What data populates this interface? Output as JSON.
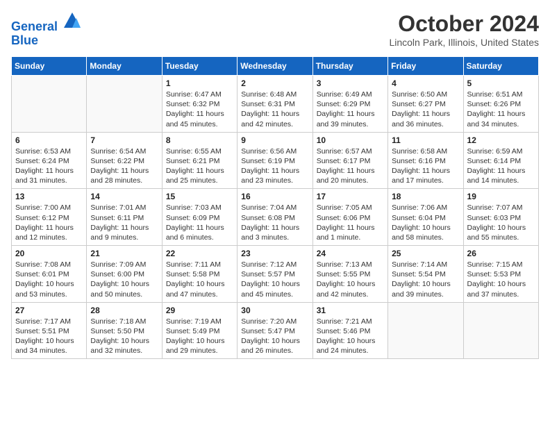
{
  "header": {
    "logo_line1": "General",
    "logo_line2": "Blue",
    "month_title": "October 2024",
    "location": "Lincoln Park, Illinois, United States"
  },
  "days_of_week": [
    "Sunday",
    "Monday",
    "Tuesday",
    "Wednesday",
    "Thursday",
    "Friday",
    "Saturday"
  ],
  "weeks": [
    [
      {
        "day": "",
        "info": ""
      },
      {
        "day": "",
        "info": ""
      },
      {
        "day": "1",
        "info": "Sunrise: 6:47 AM\nSunset: 6:32 PM\nDaylight: 11 hours and 45 minutes."
      },
      {
        "day": "2",
        "info": "Sunrise: 6:48 AM\nSunset: 6:31 PM\nDaylight: 11 hours and 42 minutes."
      },
      {
        "day": "3",
        "info": "Sunrise: 6:49 AM\nSunset: 6:29 PM\nDaylight: 11 hours and 39 minutes."
      },
      {
        "day": "4",
        "info": "Sunrise: 6:50 AM\nSunset: 6:27 PM\nDaylight: 11 hours and 36 minutes."
      },
      {
        "day": "5",
        "info": "Sunrise: 6:51 AM\nSunset: 6:26 PM\nDaylight: 11 hours and 34 minutes."
      }
    ],
    [
      {
        "day": "6",
        "info": "Sunrise: 6:53 AM\nSunset: 6:24 PM\nDaylight: 11 hours and 31 minutes."
      },
      {
        "day": "7",
        "info": "Sunrise: 6:54 AM\nSunset: 6:22 PM\nDaylight: 11 hours and 28 minutes."
      },
      {
        "day": "8",
        "info": "Sunrise: 6:55 AM\nSunset: 6:21 PM\nDaylight: 11 hours and 25 minutes."
      },
      {
        "day": "9",
        "info": "Sunrise: 6:56 AM\nSunset: 6:19 PM\nDaylight: 11 hours and 23 minutes."
      },
      {
        "day": "10",
        "info": "Sunrise: 6:57 AM\nSunset: 6:17 PM\nDaylight: 11 hours and 20 minutes."
      },
      {
        "day": "11",
        "info": "Sunrise: 6:58 AM\nSunset: 6:16 PM\nDaylight: 11 hours and 17 minutes."
      },
      {
        "day": "12",
        "info": "Sunrise: 6:59 AM\nSunset: 6:14 PM\nDaylight: 11 hours and 14 minutes."
      }
    ],
    [
      {
        "day": "13",
        "info": "Sunrise: 7:00 AM\nSunset: 6:12 PM\nDaylight: 11 hours and 12 minutes."
      },
      {
        "day": "14",
        "info": "Sunrise: 7:01 AM\nSunset: 6:11 PM\nDaylight: 11 hours and 9 minutes."
      },
      {
        "day": "15",
        "info": "Sunrise: 7:03 AM\nSunset: 6:09 PM\nDaylight: 11 hours and 6 minutes."
      },
      {
        "day": "16",
        "info": "Sunrise: 7:04 AM\nSunset: 6:08 PM\nDaylight: 11 hours and 3 minutes."
      },
      {
        "day": "17",
        "info": "Sunrise: 7:05 AM\nSunset: 6:06 PM\nDaylight: 11 hours and 1 minute."
      },
      {
        "day": "18",
        "info": "Sunrise: 7:06 AM\nSunset: 6:04 PM\nDaylight: 10 hours and 58 minutes."
      },
      {
        "day": "19",
        "info": "Sunrise: 7:07 AM\nSunset: 6:03 PM\nDaylight: 10 hours and 55 minutes."
      }
    ],
    [
      {
        "day": "20",
        "info": "Sunrise: 7:08 AM\nSunset: 6:01 PM\nDaylight: 10 hours and 53 minutes."
      },
      {
        "day": "21",
        "info": "Sunrise: 7:09 AM\nSunset: 6:00 PM\nDaylight: 10 hours and 50 minutes."
      },
      {
        "day": "22",
        "info": "Sunrise: 7:11 AM\nSunset: 5:58 PM\nDaylight: 10 hours and 47 minutes."
      },
      {
        "day": "23",
        "info": "Sunrise: 7:12 AM\nSunset: 5:57 PM\nDaylight: 10 hours and 45 minutes."
      },
      {
        "day": "24",
        "info": "Sunrise: 7:13 AM\nSunset: 5:55 PM\nDaylight: 10 hours and 42 minutes."
      },
      {
        "day": "25",
        "info": "Sunrise: 7:14 AM\nSunset: 5:54 PM\nDaylight: 10 hours and 39 minutes."
      },
      {
        "day": "26",
        "info": "Sunrise: 7:15 AM\nSunset: 5:53 PM\nDaylight: 10 hours and 37 minutes."
      }
    ],
    [
      {
        "day": "27",
        "info": "Sunrise: 7:17 AM\nSunset: 5:51 PM\nDaylight: 10 hours and 34 minutes."
      },
      {
        "day": "28",
        "info": "Sunrise: 7:18 AM\nSunset: 5:50 PM\nDaylight: 10 hours and 32 minutes."
      },
      {
        "day": "29",
        "info": "Sunrise: 7:19 AM\nSunset: 5:49 PM\nDaylight: 10 hours and 29 minutes."
      },
      {
        "day": "30",
        "info": "Sunrise: 7:20 AM\nSunset: 5:47 PM\nDaylight: 10 hours and 26 minutes."
      },
      {
        "day": "31",
        "info": "Sunrise: 7:21 AM\nSunset: 5:46 PM\nDaylight: 10 hours and 24 minutes."
      },
      {
        "day": "",
        "info": ""
      },
      {
        "day": "",
        "info": ""
      }
    ]
  ]
}
